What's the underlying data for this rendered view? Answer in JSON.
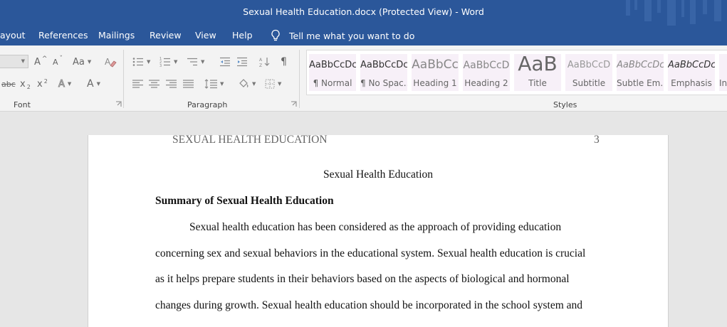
{
  "window": {
    "title": "Sexual Health Education.docx (Protected View)  -  Word"
  },
  "tabs": {
    "layout": "ayout",
    "references": "References",
    "mailings": "Mailings",
    "review": "Review",
    "view": "View",
    "help": "Help"
  },
  "tell_me": {
    "label": "Tell me what you want to do",
    "icon": "lightbulb-icon"
  },
  "ribbon": {
    "groups": {
      "font": "Font",
      "paragraph": "Paragraph",
      "styles": "Styles"
    },
    "font_buttons": {
      "grow": "A",
      "shrink": "A",
      "case": "Aa",
      "strike": "abc",
      "subscript": "x",
      "superscript": "x",
      "text_effects": "A",
      "font_color": "A"
    },
    "styles": [
      {
        "sample": "AaBbCcDc",
        "name": "¶ Normal"
      },
      {
        "sample": "AaBbCcDc",
        "name": "¶ No Spac..."
      },
      {
        "sample": "AaBbCc",
        "name": "Heading 1"
      },
      {
        "sample": "AaBbCcD",
        "name": "Heading 2"
      },
      {
        "sample": "AaB",
        "name": "Title"
      },
      {
        "sample": "AaBbCcD",
        "name": "Subtitle"
      },
      {
        "sample": "AaBbCcDc",
        "name": "Subtle Em..."
      },
      {
        "sample": "AaBbCcDc",
        "name": "Emphasis"
      },
      {
        "sample": "",
        "name": "In"
      }
    ]
  },
  "document": {
    "running_head": "SEXUAL HEALTH EDUCATION",
    "page_number": "3",
    "title": "Sexual Health Education",
    "heading": "Summary of Sexual Health Education",
    "lines": [
      "Sexual health education has been considered as the approach of providing education",
      "concerning sex and sexual behaviors in the educational system. Sexual health education is crucial",
      "as it helps prepare students in their behaviors based on the aspects of biological and hormonal",
      "changes during growth. Sexual health education should be incorporated in the school system and"
    ]
  },
  "colors": {
    "titlebar": "#2b579a",
    "ribbon": "#f3f3f3",
    "workspace": "#e6e6e6",
    "style_tile": "#f7f0f8"
  }
}
